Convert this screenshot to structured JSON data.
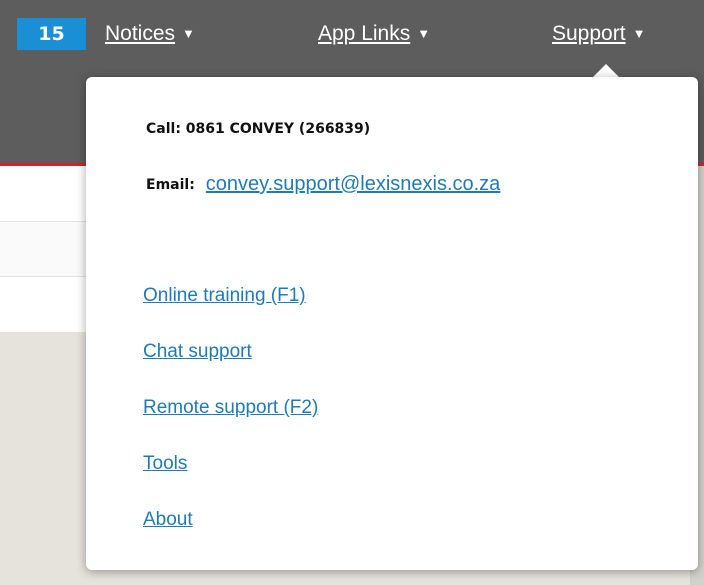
{
  "topbar": {
    "badge_count": "15",
    "nav": [
      {
        "label": "Notices"
      },
      {
        "label": "App Links"
      },
      {
        "label": "Support"
      }
    ]
  },
  "support_menu": {
    "call": "Call: 0861 CONVEY (266839)",
    "email_label": "Email:",
    "email_value": "convey.support@lexisnexis.co.za",
    "links": [
      {
        "label": "Online training (F1)"
      },
      {
        "label": "Chat support"
      },
      {
        "label": "Remote support (F2)"
      },
      {
        "label": "Tools"
      },
      {
        "label": "About"
      }
    ]
  },
  "icons": {
    "dropdown": "caret-down-icon"
  },
  "colors": {
    "topbar_bg": "#5d5d5d",
    "badge_bg": "#1a8fd6",
    "accent_red": "#d6232b",
    "link": "#1f7ab8"
  }
}
